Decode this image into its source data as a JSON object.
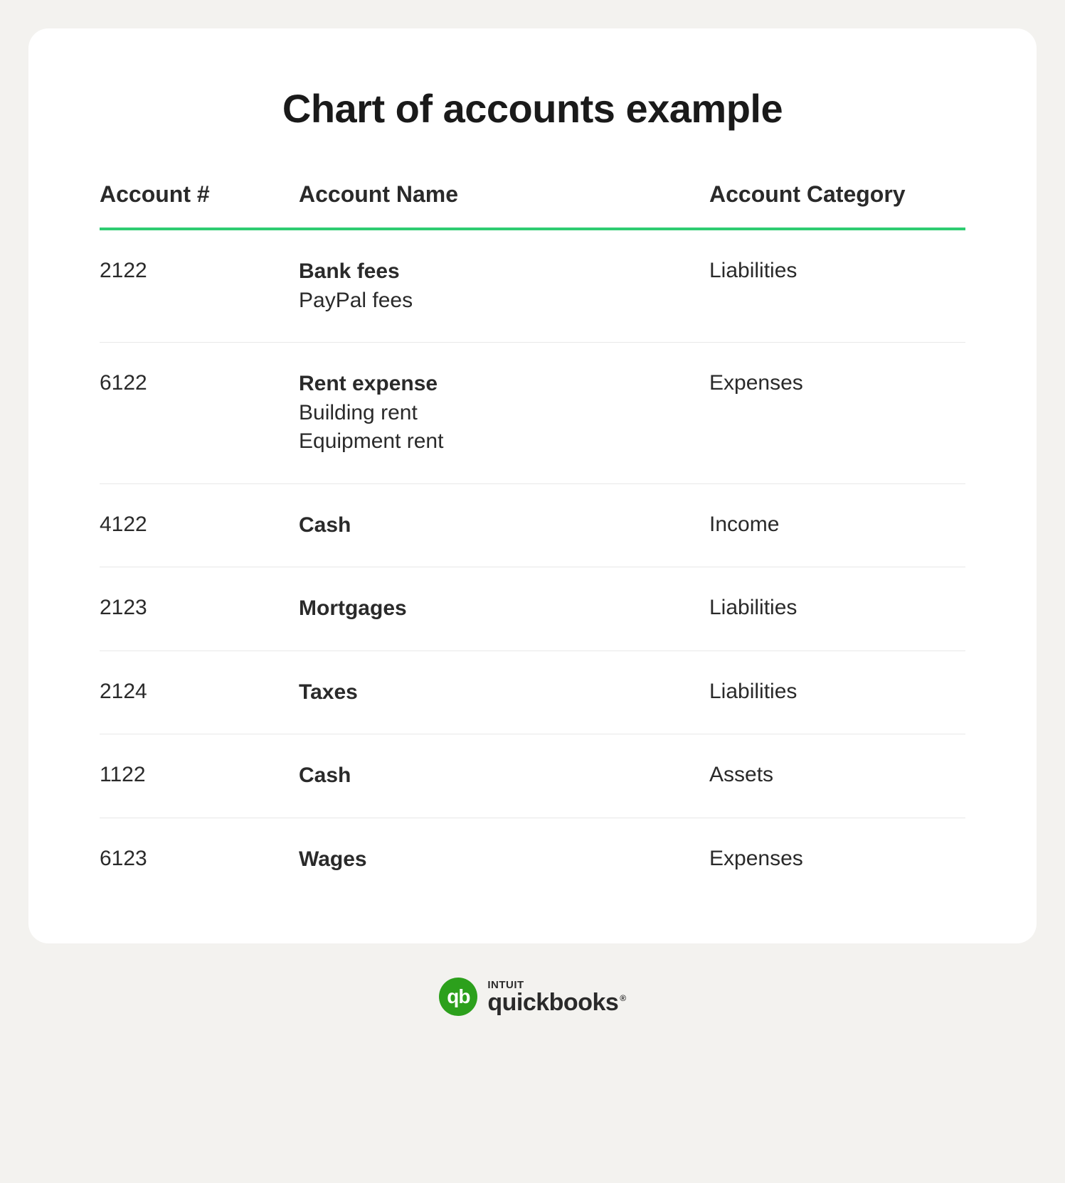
{
  "title": "Chart of accounts example",
  "columns": {
    "number": "Account #",
    "name": "Account Name",
    "category": "Account Category"
  },
  "rows": [
    {
      "number": "2122",
      "name": "Bank fees",
      "subs": [
        "PayPal fees"
      ],
      "category": "Liabilities"
    },
    {
      "number": "6122",
      "name": "Rent expense",
      "subs": [
        "Building rent",
        "Equipment rent"
      ],
      "category": "Expenses"
    },
    {
      "number": "4122",
      "name": "Cash",
      "subs": [],
      "category": "Income"
    },
    {
      "number": "2123",
      "name": "Mortgages",
      "subs": [],
      "category": "Liabilities"
    },
    {
      "number": "2124",
      "name": "Taxes",
      "subs": [],
      "category": "Liabilities"
    },
    {
      "number": "1122",
      "name": "Cash",
      "subs": [],
      "category": "Assets"
    },
    {
      "number": "6123",
      "name": "Wages",
      "subs": [],
      "category": "Expenses"
    }
  ],
  "branding": {
    "intuit": "INTUIT",
    "quickbooks": "quickbooks",
    "logo_text": "qb"
  },
  "colors": {
    "accent": "#2ecc71",
    "brand": "#2ca01c"
  }
}
